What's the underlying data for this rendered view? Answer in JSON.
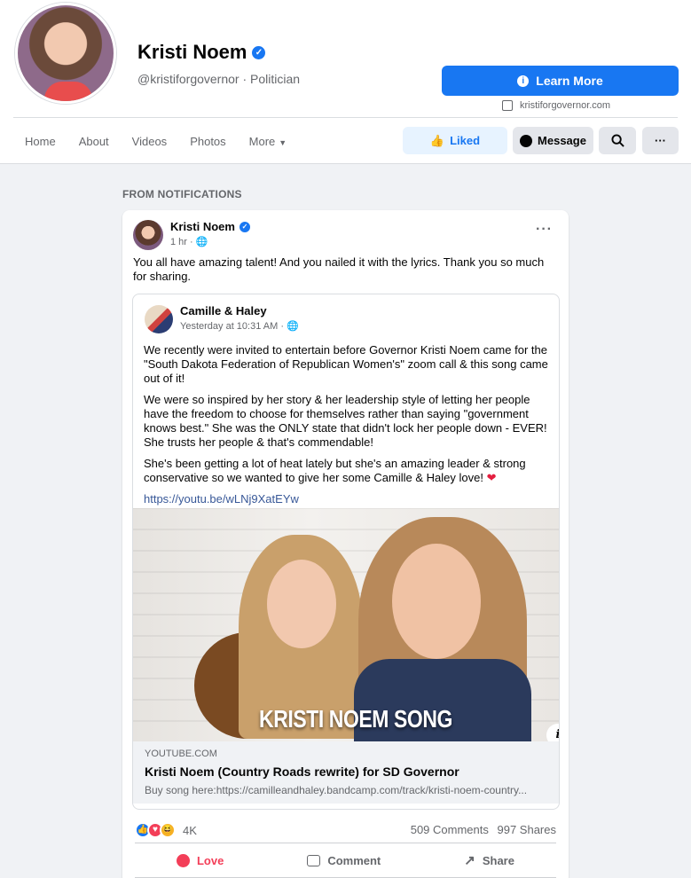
{
  "profile": {
    "name": "Kristi Noem",
    "handle_category": "@kristiforgovernor · Politician",
    "learn_more_label": "Learn More",
    "website": "kristiforgovernor.com"
  },
  "tabs": [
    {
      "label": "Home"
    },
    {
      "label": "About"
    },
    {
      "label": "Videos"
    },
    {
      "label": "Photos"
    },
    {
      "label": "More"
    }
  ],
  "actions": {
    "liked_label": "Liked",
    "message_label": "Message"
  },
  "section_label": "FROM NOTIFICATIONS",
  "post": {
    "author": "Kristi Noem",
    "time": "1 hr · ",
    "text": "You all have amazing talent! And you nailed it with the lyrics. Thank you so much for sharing.",
    "shared": {
      "author": "Camille & Haley",
      "time": "Yesterday at 10:31 AM · ",
      "paragraphs": [
        "We recently were invited to entertain before Governor Kristi Noem came for the \"South Dakota Federation of Republican Women's\" zoom call & this song came out of it!",
        "We were so inspired by her story & her leadership style of letting her people have the freedom to choose for themselves rather than saying \"government knows best.\" She was the ONLY state that didn't lock her people down - EVER! She trusts her people & that's commendable!",
        "She's been getting a lot of heat lately but she's an amazing leader & strong conservative so we wanted to give her some Camille & Haley love! "
      ],
      "heart": "❤",
      "link": "https://youtu.be/wLNj9XatEYw",
      "video_title": "KRISTI NOEM SONG",
      "link_domain": "YOUTUBE.COM",
      "link_title": "Kristi Noem (Country Roads rewrite) for SD Governor",
      "link_desc": "Buy song here:https://camilleandhaley.bandcamp.com/track/kristi-noem-country..."
    },
    "reaction_count": "4K",
    "comments": "509 Comments",
    "shares": "997 Shares",
    "love_label": "Love",
    "comment_label": "Comment",
    "share_label": "Share"
  }
}
